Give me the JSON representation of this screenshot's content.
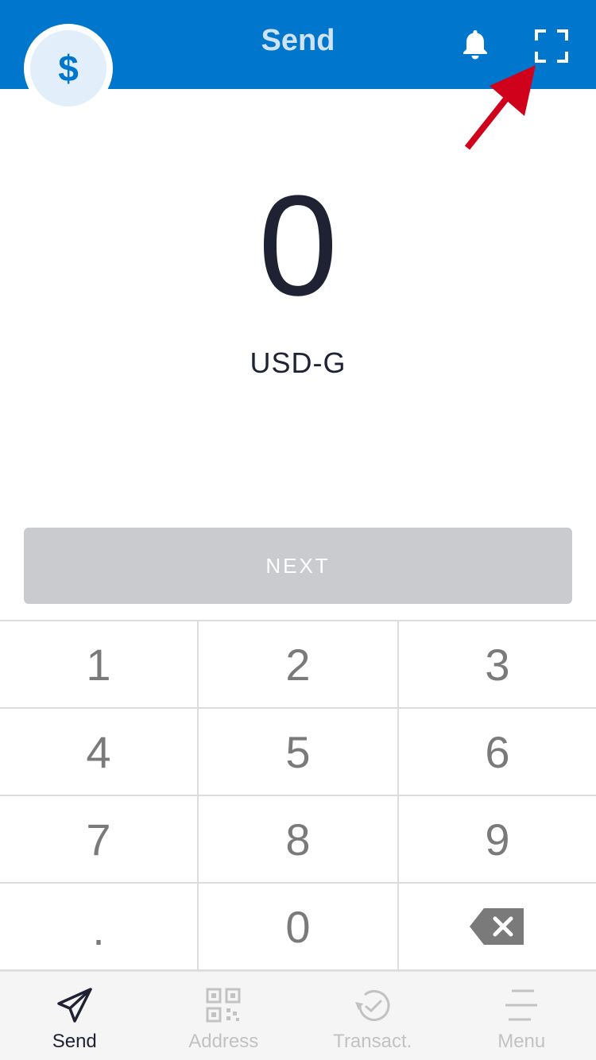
{
  "header": {
    "title": "Send",
    "avatar_symbol": "$",
    "icons": [
      "bell-icon",
      "scan-icon"
    ],
    "background_color": "#0077cc"
  },
  "amount": {
    "value": "0",
    "currency": "USD-G"
  },
  "actions": {
    "next_label": "NEXT"
  },
  "keypad": {
    "keys": [
      "1",
      "2",
      "3",
      "4",
      "5",
      "6",
      "7",
      "8",
      "9",
      ".",
      "0"
    ],
    "backspace_icon": "backspace-icon"
  },
  "bottom_nav": {
    "items": [
      {
        "label": "Send",
        "icon": "send-icon",
        "active": true
      },
      {
        "label": "Address",
        "icon": "qr-code-icon",
        "active": false
      },
      {
        "label": "Transact.",
        "icon": "history-icon",
        "active": false
      },
      {
        "label": "Menu",
        "icon": "menu-icon",
        "active": false
      }
    ]
  },
  "annotation": {
    "arrow_color": "#d0021b"
  }
}
